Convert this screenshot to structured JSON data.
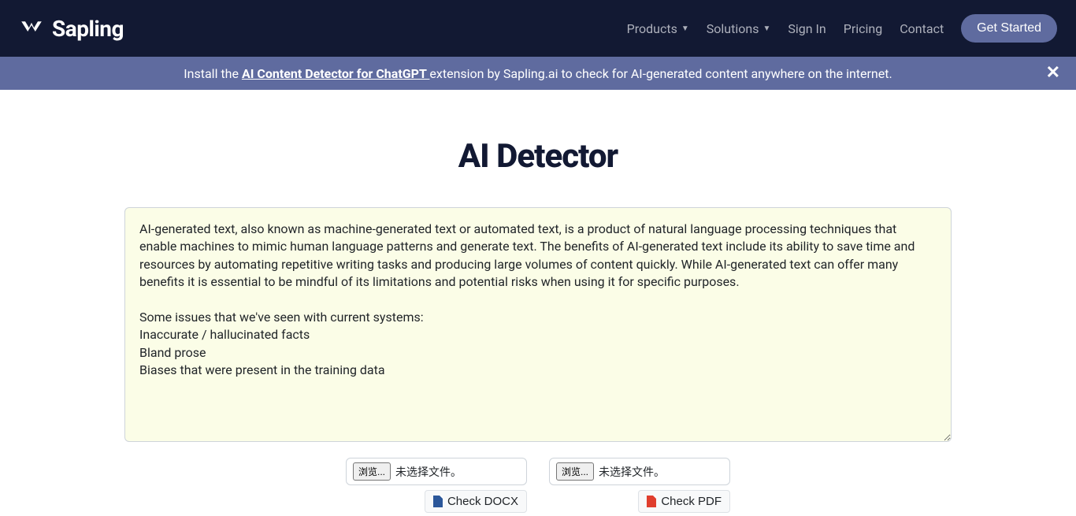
{
  "nav": {
    "brand": "Sapling",
    "items": {
      "products": "Products",
      "solutions": "Solutions",
      "signin": "Sign In",
      "pricing": "Pricing",
      "contact": "Contact"
    },
    "cta": "Get Started"
  },
  "banner": {
    "prefix": "Install the ",
    "link_text": "AI Content Detector for ChatGPT ",
    "suffix": " extension by Sapling.ai to check for AI-generated content anywhere on the internet."
  },
  "page": {
    "title": "AI Detector"
  },
  "textarea": {
    "value": "AI-generated text, also known as machine-generated text or automated text, is a product of natural language processing techniques that enable machines to mimic human language patterns and generate text. The benefits of AI-generated text include its ability to save time and resources by automating repetitive writing tasks and producing large volumes of content quickly. While AI-generated text can offer many benefits it is essential to be mindful of its limitations and potential risks when using it for specific purposes.\n\nSome issues that we've seen with current systems:\nInaccurate / hallucinated facts\nBland prose\nBiases that were present in the training data"
  },
  "file_controls": {
    "browse_label": "浏览...",
    "no_file_label": "未选择文件。",
    "check_docx": "Check DOCX",
    "check_pdf": "Check PDF"
  }
}
